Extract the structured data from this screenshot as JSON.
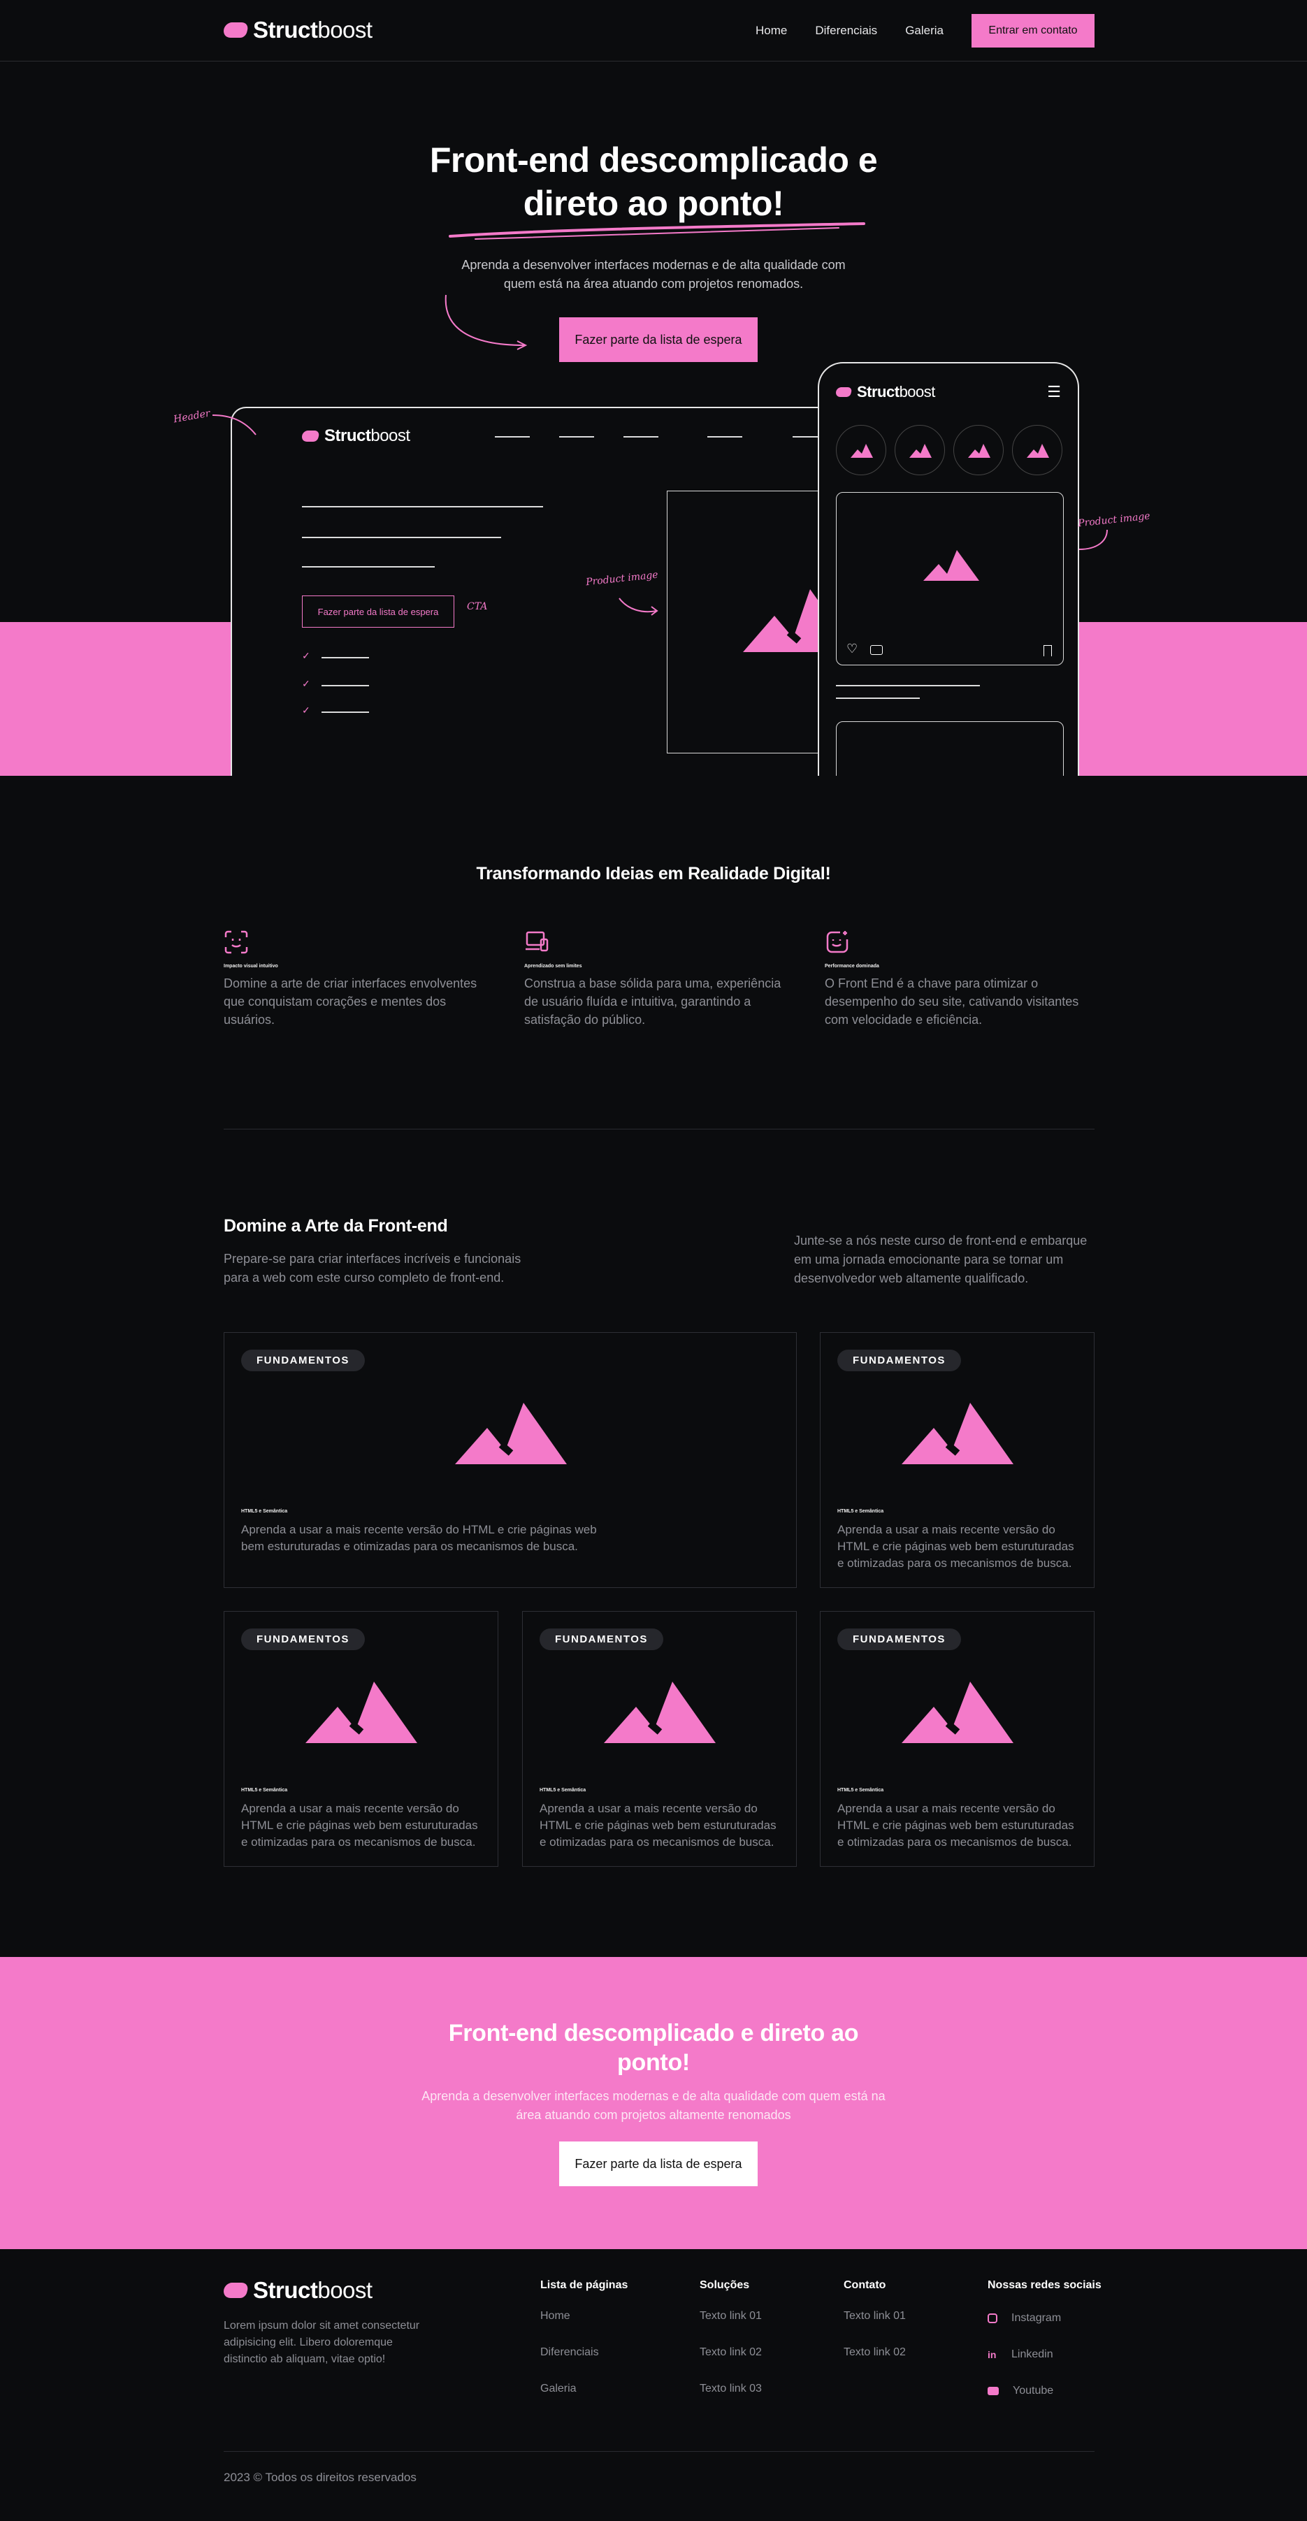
{
  "header": {
    "logo_bold": "Struct",
    "logo_light": "boost",
    "nav": [
      "Home",
      "Diferenciais",
      "Galeria"
    ],
    "cta": "Entrar em contato"
  },
  "hero": {
    "title_line1": "Front-end descomplicado e",
    "title_line2": "direto ao ponto!",
    "subtitle": "Aprenda a desenvolver interfaces modernas e de alta qualidade com quem está na área atuando com projetos renomados.",
    "button": "Fazer parte da lista de espera",
    "annotations": {
      "header": "Header",
      "cta": "CTA",
      "product_image_left": "Product image",
      "product_image_right": "Product image"
    },
    "mock": {
      "logo_bold": "Struct",
      "logo_light": "boost",
      "button": "Fazer parte da lista de espera"
    }
  },
  "features": {
    "title": "Transformando Ideias em Realidade Digital!",
    "items": [
      {
        "icon": "face-scan-icon",
        "title": "Impacto visual intuitivo",
        "desc": "Domine a arte de criar interfaces envolventes que conquistam corações e mentes dos usuários."
      },
      {
        "icon": "laptop-phone-icon",
        "title": "Aprendizado sem limites",
        "desc": "Construa a base sólida para uma, experiência de usuário fluída e intuitiva, garantindo a satisfação do público."
      },
      {
        "icon": "sparkle-smile-icon",
        "title": "Performance dominada",
        "desc": "O Front End é a chave para otimizar o desempenho do seu site, cativando visitantes com velocidade e eficiência."
      }
    ]
  },
  "course": {
    "title": "Domine a Arte da Front-end",
    "subtitle": "Prepare-se para criar interfaces incríveis e funcionais para a web com este curso completo de front-end.",
    "side_text": "Junte-se a nós neste curso de front-end e embarque em uma jornada emocionante para se tornar um desenvolvedor web altamente qualificado.",
    "cards": [
      {
        "badge": "FUNDAMENTOS",
        "title": "HTML5 e Semântica",
        "desc": "Aprenda a usar a mais recente versão do HTML e crie páginas web bem esturuturadas e otimizadas para os mecanismos de busca."
      },
      {
        "badge": "FUNDAMENTOS",
        "title": "HTML5 e Semântica",
        "desc": "Aprenda a usar a mais recente versão do HTML e crie páginas web bem esturuturadas e otimizadas para os mecanismos de busca."
      },
      {
        "badge": "FUNDAMENTOS",
        "title": "HTML5 e Semântica",
        "desc": "Aprenda a usar a mais recente versão do HTML e crie páginas web bem esturuturadas e otimizadas para os mecanismos de busca."
      },
      {
        "badge": "FUNDAMENTOS",
        "title": "HTML5 e Semântica",
        "desc": "Aprenda a usar a mais recente versão do HTML e crie páginas web bem esturuturadas e otimizadas para os mecanismos de busca."
      },
      {
        "badge": "FUNDAMENTOS",
        "title": "HTML5 e Semântica",
        "desc": "Aprenda a usar a mais recente versão do HTML e crie páginas web bem esturuturadas e otimizadas para os mecanismos de busca."
      }
    ]
  },
  "cta": {
    "title_line1": "Front-end descomplicado e direto ao",
    "title_line2": "ponto!",
    "subtitle": "Aprenda a desenvolver interfaces modernas e de alta qualidade com quem está na área atuando com projetos altamente renomados",
    "button": "Fazer parte da lista de espera"
  },
  "footer": {
    "logo_bold": "Struct",
    "logo_light": "boost",
    "about": "Lorem ipsum dolor sit amet consectetur adipisicing elit. Libero doloremque distinctio ab aliquam, vitae optio!",
    "columns": [
      {
        "title": "Lista de páginas",
        "links": [
          "Home",
          "Diferenciais",
          "Galeria"
        ]
      },
      {
        "title": "Soluções",
        "links": [
          "Texto link 01",
          "Texto link 02",
          "Texto link 03"
        ]
      },
      {
        "title": "Contato",
        "links": [
          "Texto link 01",
          "Texto link 02"
        ]
      }
    ],
    "social_title": "Nossas redes sociais",
    "social": [
      {
        "icon": "instagram-icon",
        "label": "Instagram"
      },
      {
        "icon": "linkedin-icon",
        "label": "Linkedin"
      },
      {
        "icon": "youtube-icon",
        "label": "Youtube"
      }
    ],
    "copyright": "2023 © Todos os direitos reservados"
  },
  "colors": {
    "accent": "#f47ac9",
    "background": "#0b0c0e",
    "muted": "#8e8f96"
  }
}
